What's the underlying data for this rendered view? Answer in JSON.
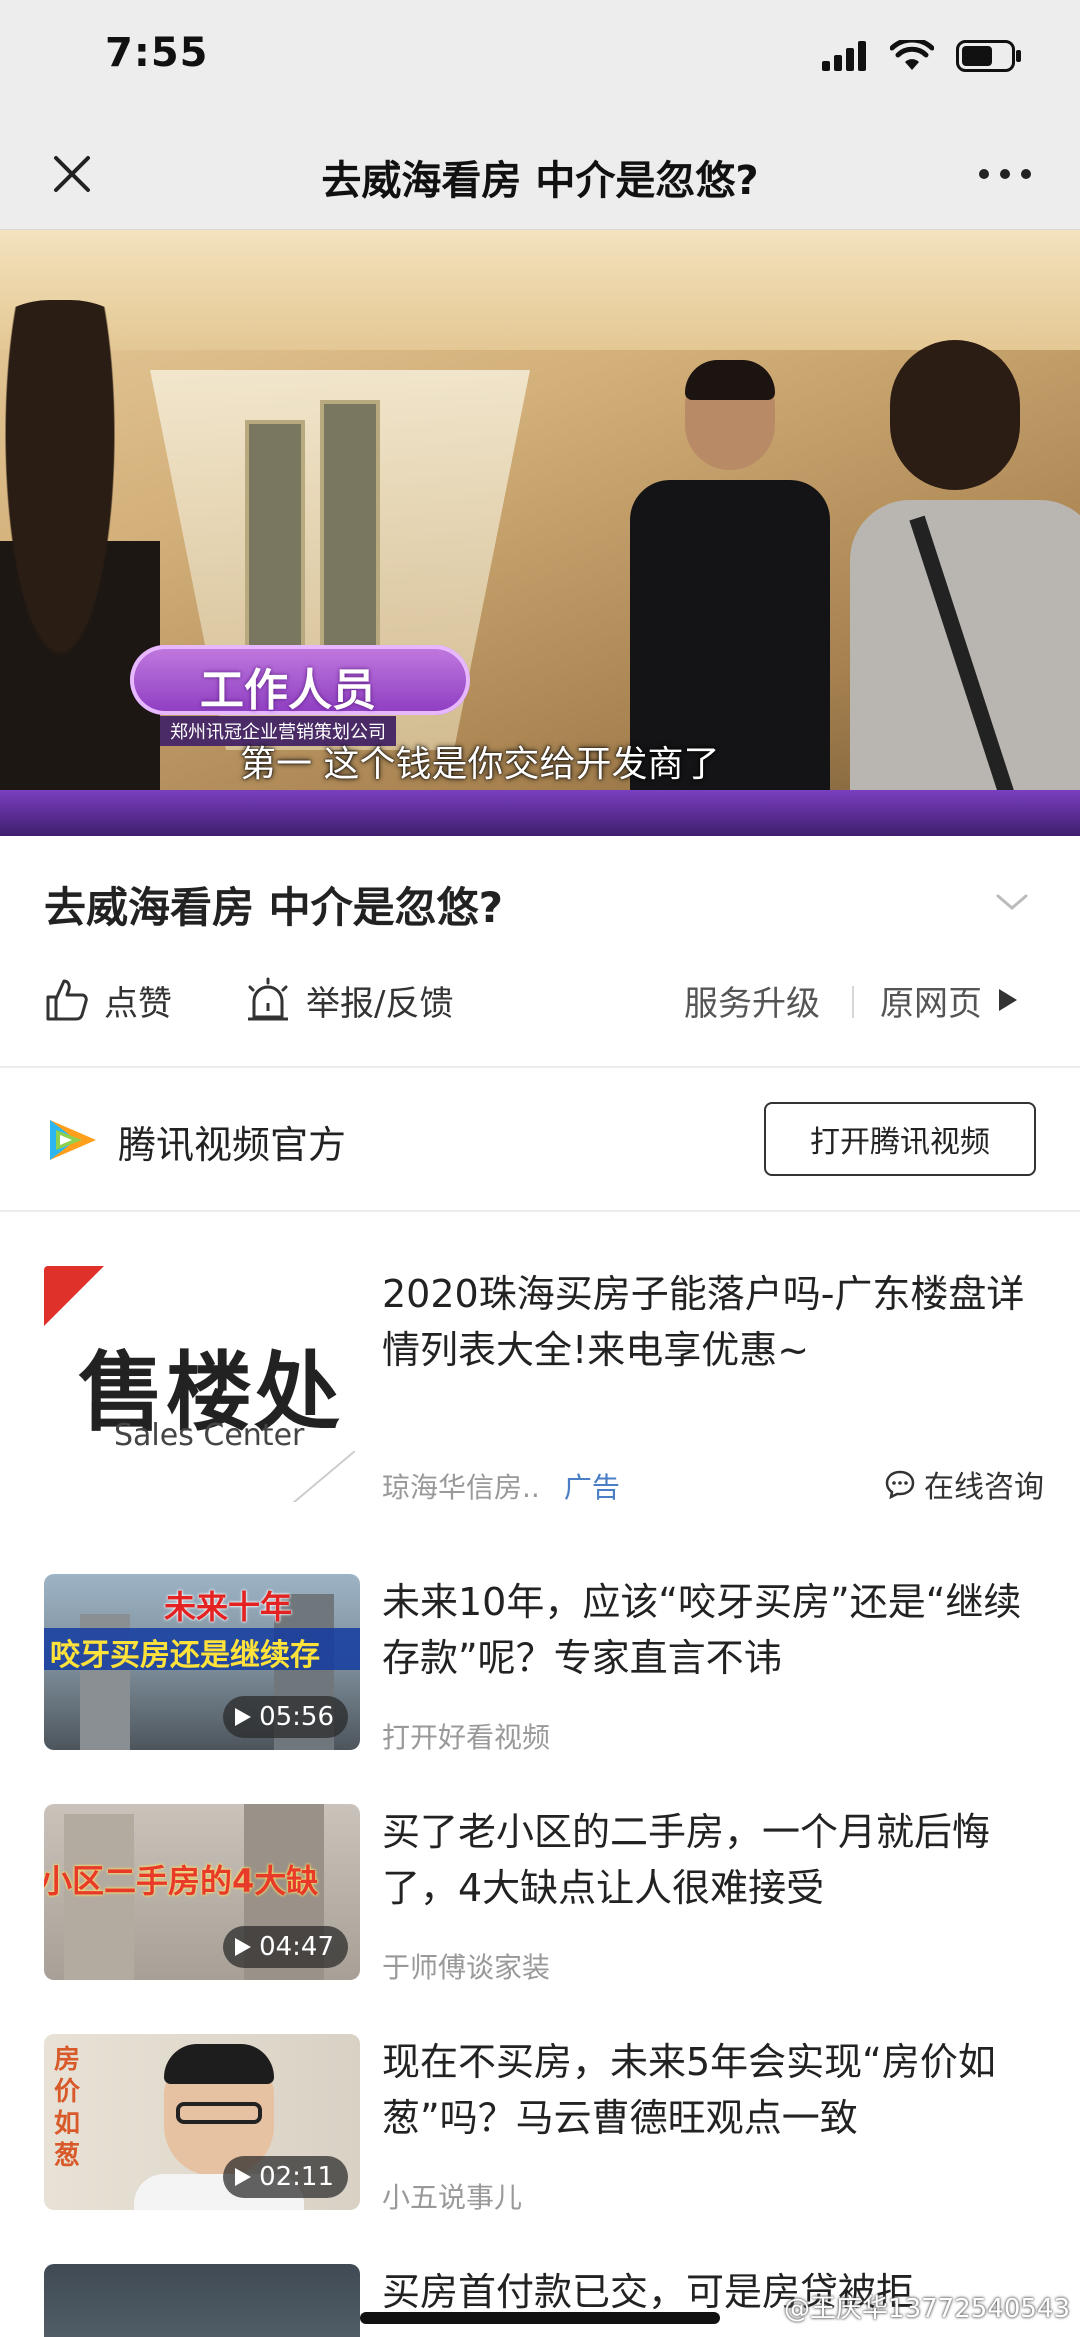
{
  "status_bar": {
    "time": "7:55"
  },
  "nav": {
    "title": "去威海看房 中介是忽悠?"
  },
  "video": {
    "caption_name": "工作人员",
    "caption_company": "郑州讯冠企业营销策划公司",
    "subtitle": "第一 这个钱是你交给开发商了"
  },
  "article": {
    "title": "去威海看房 中介是忽悠?",
    "actions": {
      "like": "点赞",
      "report": "举报/反馈",
      "upgrade": "服务升级",
      "original": "原网页"
    }
  },
  "source": {
    "name": "腾讯视频官方",
    "open_button": "打开腾讯视频"
  },
  "feed": [
    {
      "title": "2020珠海买房子能落户吗-广东楼盘详情列表大全!来电享优惠~",
      "author": "琼海华信房..",
      "ad_label": "广告",
      "consult": "在线咨询",
      "thumb_main": "售楼处",
      "thumb_sub": "Sales Center"
    },
    {
      "title": "未来10年，应该“咬牙买房”还是“继续存款”呢？专家直言不讳",
      "author": "打开好看视频",
      "duration": "05:56",
      "thumb_line1": "未来十年",
      "thumb_line2": "咬牙买房还是继续存"
    },
    {
      "title": "买了老小区的二手房，一个月就后悔了，4大缺点让人很难接受",
      "author": "于师傅谈家装",
      "duration": "04:47",
      "thumb_line1": "小区二手房的4大缺"
    },
    {
      "title": "现在不买房，未来5年会实现“房价如葱”吗？马云曹德旺观点一致",
      "author": "小五说事儿",
      "duration": "02:11",
      "thumb_side": "房价如葱"
    },
    {
      "title": "买房首付款已交，可是房贷被拒"
    }
  ],
  "watermark": "@王庆华13772540543"
}
